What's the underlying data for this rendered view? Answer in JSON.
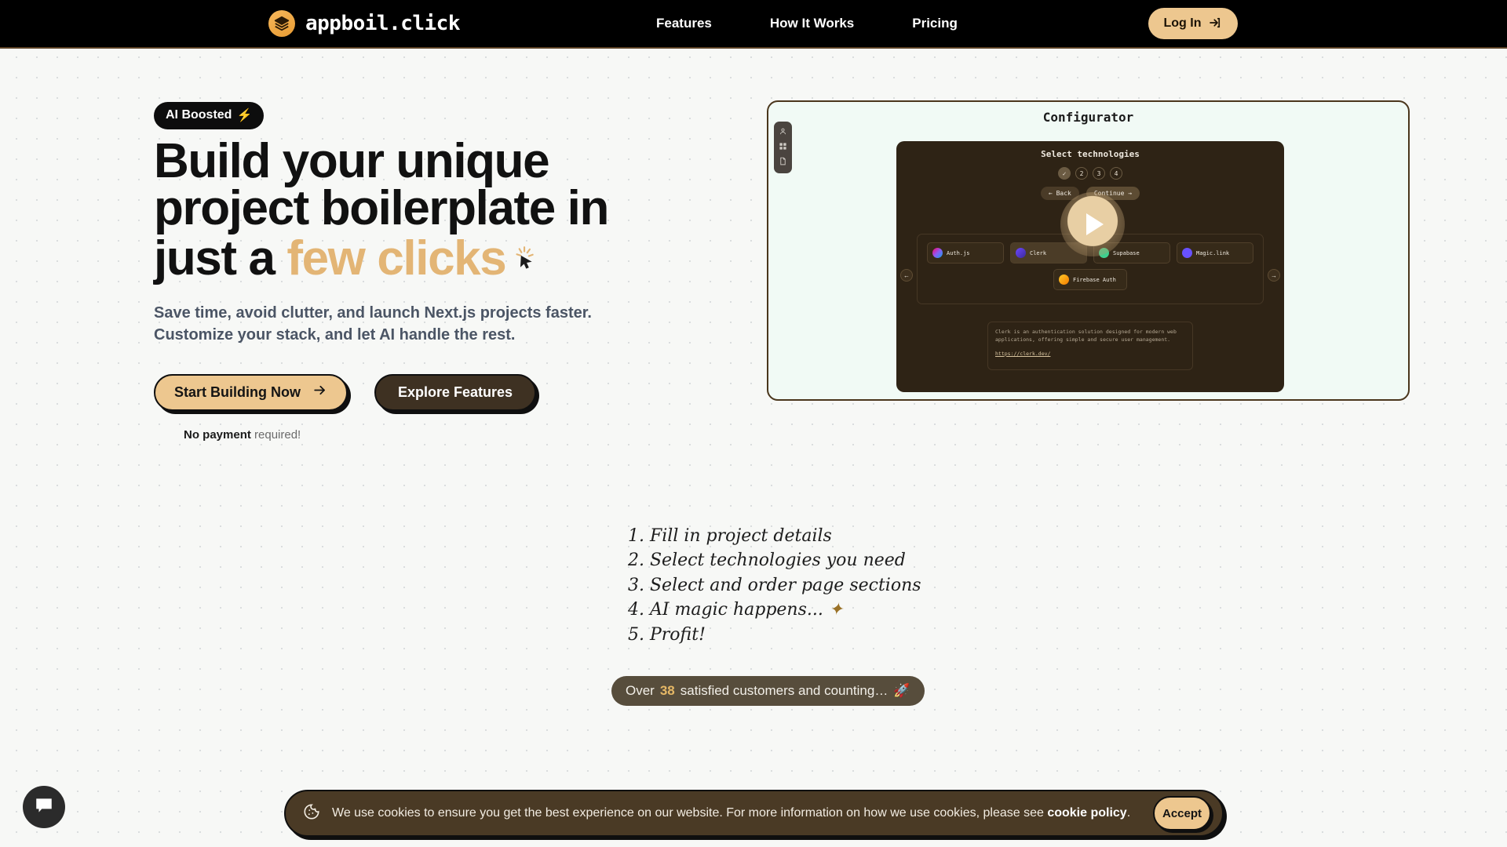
{
  "navbar": {
    "brand": {
      "name": "appboil.click",
      "logo_icon": "layers-icon"
    },
    "links": [
      {
        "label": "Features"
      },
      {
        "label": "How It Works"
      },
      {
        "label": "Pricing"
      }
    ],
    "login": {
      "label": "Log In",
      "icon": "login-arrow-icon"
    }
  },
  "hero": {
    "badge": {
      "label": "AI Boosted",
      "emoji": "⚡"
    },
    "headline_line1": "Build your unique",
    "headline_line2": "project boilerplate in",
    "headline_line3_plain": "just a ",
    "headline_line3_accent": "few clicks",
    "cursor_icon": "click-cursor-icon",
    "subtitle": "Save time, avoid clutter, and launch Next.js projects faster. Customize your stack, and let AI handle the rest.",
    "primary_cta": {
      "label": "Start Building Now",
      "icon": "arrow-right-icon"
    },
    "secondary_cta": {
      "label": "Explore Features"
    },
    "note_bold": "No payment",
    "note_rest": " required!"
  },
  "video_panel": {
    "title": "Configurator",
    "sidebar_icons": [
      "user-icon",
      "grid-icon",
      "document-icon"
    ],
    "configurator": {
      "title": "Select technologies",
      "steps": [
        "✓",
        "2",
        "3",
        "4"
      ],
      "back_label": "← Back",
      "continue_label": "Continue →",
      "tech_cards": [
        {
          "label": "Auth.js",
          "color": "#8b5cf6"
        },
        {
          "label": "Clerk",
          "color": "#6c47ff"
        },
        {
          "label": "Supabase",
          "color": "#3ecf8e"
        },
        {
          "label": "Magic.link",
          "color": "#6851ff"
        }
      ],
      "tech_card_bottom": {
        "label": "Firebase Auth",
        "color": "#ffca28"
      },
      "description": "Clerk is an authentication solution designed for modern web applications, offering simple and secure user management.",
      "description_link": "https://clerk.dev/",
      "prev_arrow": "←",
      "next_arrow": "→",
      "carousel_dot_count": 11,
      "carousel_active_index": 4
    },
    "play_button": "play-icon"
  },
  "steps_list": [
    "1. Fill in project details",
    "2. Select technologies you need",
    "3. Select and order page sections",
    "4. AI magic happens...",
    "5. Profit!"
  ],
  "steps_list_sparkle": "✦",
  "customers": {
    "prefix": "Over ",
    "count": "38",
    "suffix": " satisfied customers and counting…",
    "emoji": "🚀"
  },
  "chat": {
    "icon": "chat-bubble-icon"
  },
  "cookie_banner": {
    "icon": "cookie-icon",
    "text_before": "We use cookies to ensure you get the best experience on our website. For more information on how we use cookies, please see ",
    "link_text": "cookie policy",
    "text_after": ".",
    "accept_label": "Accept"
  },
  "colors": {
    "accent_tan": "#edc78f",
    "dark_brown": "#4a3a25",
    "panel_brown": "#2e2315",
    "nav_black": "#000000",
    "page_bg": "#f7f8f6"
  }
}
